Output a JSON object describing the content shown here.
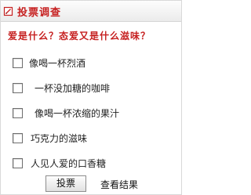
{
  "poll": {
    "title": "投票调查",
    "title_icon": "edit-form-icon",
    "question": "爱是什么？态爱又是什么滋味？",
    "options": [
      {
        "label": "像喝一杯烈酒",
        "checked": false
      },
      {
        "label": "一杯没加糖的咖啡",
        "checked": false
      },
      {
        "label": "像喝一杯浓缩的果汁",
        "checked": false
      },
      {
        "label": "巧克力的滋味",
        "checked": false
      },
      {
        "label": "人见人爱的口香糖",
        "checked": false
      }
    ],
    "vote_label": "投票",
    "results_label": "查看结果"
  },
  "colors": {
    "accent": "#c62020",
    "header_bg_top": "#fdfdfd",
    "header_bg_bottom": "#ebebeb",
    "border": "#d9d9d9",
    "text": "#222222"
  }
}
